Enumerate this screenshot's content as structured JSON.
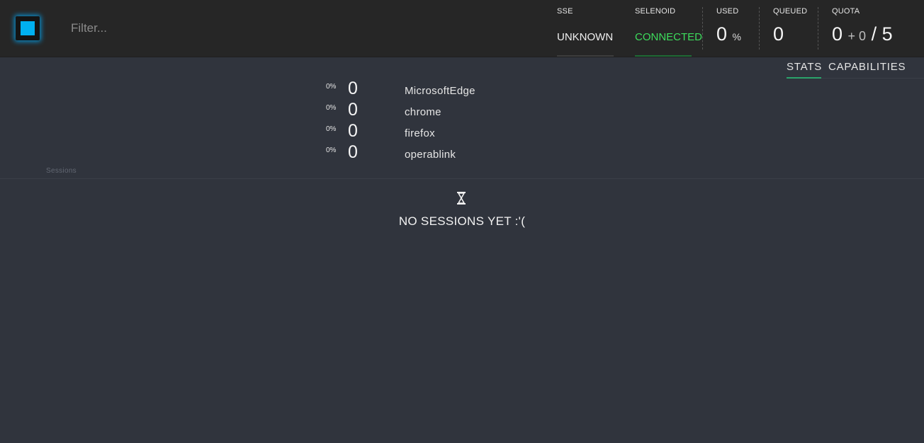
{
  "header": {
    "logo_icon": "selenoid-logo-icon",
    "filter": {
      "placeholder": "Filter...",
      "value": ""
    },
    "sse": {
      "label": "SSE",
      "value": "UNKNOWN"
    },
    "selenoid": {
      "label": "SELENOID",
      "value": "CONNECTED",
      "color": "#3ddc5c"
    },
    "used": {
      "label": "USED",
      "value": "0",
      "suffix": "%"
    },
    "queued": {
      "label": "QUEUED",
      "value": "0"
    },
    "quota": {
      "label": "QUOTA",
      "used": "0",
      "pending": "+ 0",
      "total": "/ 5"
    }
  },
  "tabs": [
    {
      "label": "STATS",
      "active": true
    },
    {
      "label": "CAPABILITIES",
      "active": false
    }
  ],
  "browsers": [
    {
      "pct": "0%",
      "count": "0",
      "name": "MicrosoftEdge"
    },
    {
      "pct": "0%",
      "count": "0",
      "name": "chrome"
    },
    {
      "pct": "0%",
      "count": "0",
      "name": "firefox"
    },
    {
      "pct": "0%",
      "count": "0",
      "name": "operablink"
    }
  ],
  "sessions": {
    "label": "Sessions",
    "empty_icon": "hourglass-icon",
    "empty_message": "NO SESSIONS YET :'("
  },
  "colors": {
    "accent": "#00b0f0",
    "connected": "#3ddc5c",
    "active_tab": "#2aa36b",
    "background": "#30343d",
    "header": "#262626"
  }
}
